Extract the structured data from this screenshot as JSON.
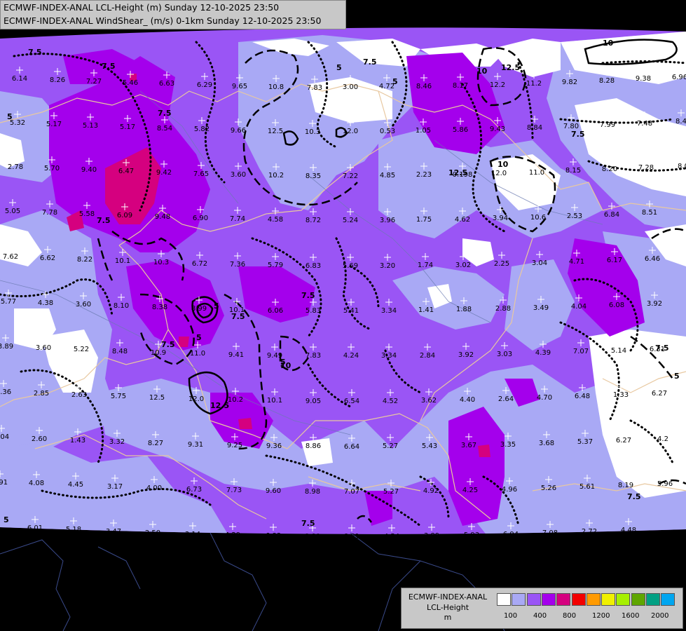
{
  "header": {
    "line1": "ECMWF-INDEX-ANAL LCL-Height (m) Sunday 12-10-2025 23:50",
    "line2": "ECMWF-INDEX-ANAL WindShear_ (m/s) 0-1km Sunday 12-10-2025 23:50"
  },
  "legend": {
    "title1": "ECMWF-INDEX-ANAL",
    "title2": "LCL-Height",
    "title3": "m",
    "colors": [
      "#ffffff",
      "#a9a9f5",
      "#9a55f5",
      "#a400ec",
      "#d5007f",
      "#f30000",
      "#ff9a00",
      "#f0f000",
      "#a6f000",
      "#5fa600",
      "#00a083",
      "#00a6f0"
    ],
    "ticks": [
      "100",
      "400",
      "800",
      "1200",
      "1600",
      "2000"
    ]
  },
  "map_values": [
    {
      "t": "6.14"
    },
    {
      "t": "8.26"
    },
    {
      "t": "7.27"
    },
    {
      "t": "5.46"
    },
    {
      "t": "6.63"
    },
    {
      "t": "6.29"
    },
    {
      "t": "9.65"
    },
    {
      "t": "10.8"
    },
    {
      "t": "7.83"
    },
    {
      "t": "3.00"
    },
    {
      "t": "4.72"
    },
    {
      "t": "8.46"
    },
    {
      "t": "8.17"
    },
    {
      "t": "12.2"
    },
    {
      "t": "11.2"
    },
    {
      "t": "9.82"
    },
    {
      "t": "8.28"
    },
    {
      "t": "9.38"
    },
    {
      "t": "6.96"
    },
    {
      "t": "5.32"
    },
    {
      "t": "5.17"
    },
    {
      "t": "5.13"
    },
    {
      "t": "5.17"
    },
    {
      "t": "8.54"
    },
    {
      "t": "5.82"
    },
    {
      "t": "9.66"
    },
    {
      "t": "12.5"
    },
    {
      "t": "10.3"
    },
    {
      "t": "12.0"
    },
    {
      "t": "0.53"
    },
    {
      "t": "1.05"
    },
    {
      "t": "5.86"
    },
    {
      "t": "9.43"
    },
    {
      "t": "8.84"
    },
    {
      "t": "7.80"
    },
    {
      "t": "7.99"
    },
    {
      "t": "7.48"
    },
    {
      "t": "8.4"
    },
    {
      "t": "2.78"
    },
    {
      "t": "5.70"
    },
    {
      "t": "9.40"
    },
    {
      "t": "6.47"
    },
    {
      "t": "9.42"
    },
    {
      "t": "7.65"
    },
    {
      "t": "3.60"
    },
    {
      "t": "10.2"
    },
    {
      "t": "8.35"
    },
    {
      "t": "7.22"
    },
    {
      "t": "4.85"
    },
    {
      "t": "2.23"
    },
    {
      "t": "0.198"
    },
    {
      "t": "12.0"
    },
    {
      "t": "11.0"
    },
    {
      "t": "8.15"
    },
    {
      "t": "8.20"
    },
    {
      "t": "7.28"
    },
    {
      "t": "8.0"
    },
    {
      "t": "5.05"
    },
    {
      "t": "7.78"
    },
    {
      "t": "5.58"
    },
    {
      "t": "6.09"
    },
    {
      "t": "9.48"
    },
    {
      "t": "6.90"
    },
    {
      "t": "7.74"
    },
    {
      "t": "4.58"
    },
    {
      "t": "8.72"
    },
    {
      "t": "5.24"
    },
    {
      "t": "3.96"
    },
    {
      "t": "1.75"
    },
    {
      "t": "4.62"
    },
    {
      "t": "3.94"
    },
    {
      "t": "10.6"
    },
    {
      "t": "2.53"
    },
    {
      "t": "6.84"
    },
    {
      "t": "8.51"
    },
    {
      "t": "7.62"
    },
    {
      "t": "6.62"
    },
    {
      "t": "8.22"
    },
    {
      "t": "10.1"
    },
    {
      "t": "10.3"
    },
    {
      "t": "6.72"
    },
    {
      "t": "7.36"
    },
    {
      "t": "5.79"
    },
    {
      "t": "6.83"
    },
    {
      "t": "5.69"
    },
    {
      "t": "3.20"
    },
    {
      "t": "1.74"
    },
    {
      "t": "3.02"
    },
    {
      "t": "2.25"
    },
    {
      "t": "3.04"
    },
    {
      "t": "4.71"
    },
    {
      "t": "6.17"
    },
    {
      "t": "6.46"
    },
    {
      "t": "5.77"
    },
    {
      "t": "4.38"
    },
    {
      "t": "3.60"
    },
    {
      "t": "8.10"
    },
    {
      "t": "8.38"
    },
    {
      "t": "8.99"
    },
    {
      "t": "10.1"
    },
    {
      "t": "6.06"
    },
    {
      "t": "5.83"
    },
    {
      "t": "5.41"
    },
    {
      "t": "3.34"
    },
    {
      "t": "1.41"
    },
    {
      "t": "1.88"
    },
    {
      "t": "2.88"
    },
    {
      "t": "3.49"
    },
    {
      "t": "4.04"
    },
    {
      "t": "6.08"
    },
    {
      "t": "3.92"
    },
    {
      "t": "3.89"
    },
    {
      "t": "3.60"
    },
    {
      "t": "5.22"
    },
    {
      "t": "8.48"
    },
    {
      "t": "10.9"
    },
    {
      "t": "11.0"
    },
    {
      "t": "9.41"
    },
    {
      "t": "9.49"
    },
    {
      "t": "7.83"
    },
    {
      "t": "4.24"
    },
    {
      "t": "3.34"
    },
    {
      "t": "2.84"
    },
    {
      "t": "3.92"
    },
    {
      "t": "3.03"
    },
    {
      "t": "4.39"
    },
    {
      "t": "7.07"
    },
    {
      "t": "5.14"
    },
    {
      "t": "6.31"
    },
    {
      "t": "2.36"
    },
    {
      "t": "2.85"
    },
    {
      "t": "2.63"
    },
    {
      "t": "5.75"
    },
    {
      "t": "12.5"
    },
    {
      "t": "12.0"
    },
    {
      "t": "10.2"
    },
    {
      "t": "10.1"
    },
    {
      "t": "9.05"
    },
    {
      "t": "6.54"
    },
    {
      "t": "4.52"
    },
    {
      "t": "3.62"
    },
    {
      "t": "4.40"
    },
    {
      "t": "2.64"
    },
    {
      "t": "4.70"
    },
    {
      "t": "6.48"
    },
    {
      "t": "1.33"
    },
    {
      "t": "6.27"
    },
    {
      "t": "4.04"
    },
    {
      "t": "2.60"
    },
    {
      "t": "1.43"
    },
    {
      "t": "3.32"
    },
    {
      "t": "8.27"
    },
    {
      "t": "9.31"
    },
    {
      "t": "9.25"
    },
    {
      "t": "9.36"
    },
    {
      "t": "8.86"
    },
    {
      "t": "6.64"
    },
    {
      "t": "5.27"
    },
    {
      "t": "5.43"
    },
    {
      "t": "3.67"
    },
    {
      "t": "3.35"
    },
    {
      "t": "3.68"
    },
    {
      "t": "5.37"
    },
    {
      "t": "6.27"
    },
    {
      "t": "4.2"
    },
    {
      "t": "3.91"
    },
    {
      "t": "4.08"
    },
    {
      "t": "4.45"
    },
    {
      "t": "3.17"
    },
    {
      "t": "4.00"
    },
    {
      "t": "6.73"
    },
    {
      "t": "7.73"
    },
    {
      "t": "9.60"
    },
    {
      "t": "8.98"
    },
    {
      "t": "7.07"
    },
    {
      "t": "5.27"
    },
    {
      "t": "4.92"
    },
    {
      "t": "4.25"
    },
    {
      "t": "4.96"
    },
    {
      "t": "5.26"
    },
    {
      "t": "5.61"
    },
    {
      "t": "8.19"
    },
    {
      "t": "5.96"
    },
    {
      "t": "6.01"
    },
    {
      "t": "5.18"
    },
    {
      "t": "3.47"
    },
    {
      "t": "2.50"
    },
    {
      "t": "3.14"
    },
    {
      "t": "4.29"
    },
    {
      "t": "6.83"
    },
    {
      "t": "8.80"
    },
    {
      "t": "8.81"
    },
    {
      "t": "4.54"
    },
    {
      "t": "3.89"
    },
    {
      "t": "5.93"
    },
    {
      "t": "6.94"
    },
    {
      "t": "7.08"
    },
    {
      "t": "2.72"
    },
    {
      "t": "4.48"
    }
  ],
  "contour_labels": [
    "7.5",
    "7.5",
    "5",
    "10",
    "12.5",
    "10",
    "7.5",
    "5",
    "5",
    "7.5",
    "7.5",
    "10",
    "12.5",
    "7.5",
    "7.5",
    "5",
    "7.5",
    "5",
    "5",
    "7.5",
    "10",
    "12.5",
    "7.5",
    "5",
    "7.5",
    "7.5",
    "5"
  ]
}
